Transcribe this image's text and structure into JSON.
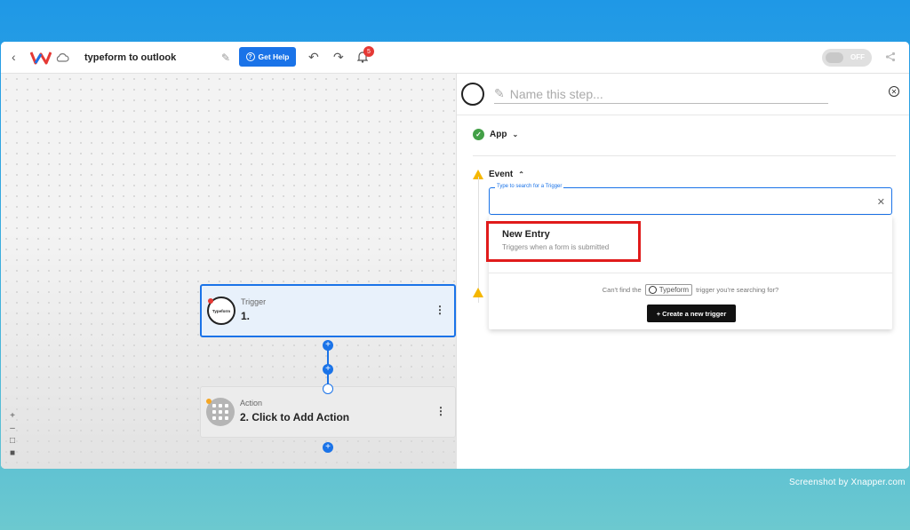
{
  "header": {
    "title": "typeform to outlook",
    "help_label": "Get Help",
    "notification_count": "5",
    "toggle_label": "OFF"
  },
  "canvas": {
    "trigger": {
      "type": "Trigger",
      "title": "1.",
      "icon_text": "Typeform"
    },
    "action": {
      "type": "Action",
      "title": "2. Click to Add Action"
    }
  },
  "panel": {
    "step_name_placeholder": "Name this step...",
    "app_label": "App",
    "event_label": "Event",
    "search": {
      "label": "Type to search for a Trigger",
      "value": ""
    },
    "options": [
      {
        "title": "New Entry",
        "description": "Triggers when a form is submitted"
      }
    ],
    "cant_find_prefix": "Can't find the",
    "cant_find_app": "Typeform",
    "cant_find_suffix": "trigger you're searching for?",
    "create_button": "+ Create a new trigger"
  },
  "watermark": "Screenshot by Xnapper.com",
  "colors": {
    "accent": "#1a73e8",
    "highlight": "#e01b1b",
    "success": "#43a047",
    "warning": "#f5b700"
  }
}
